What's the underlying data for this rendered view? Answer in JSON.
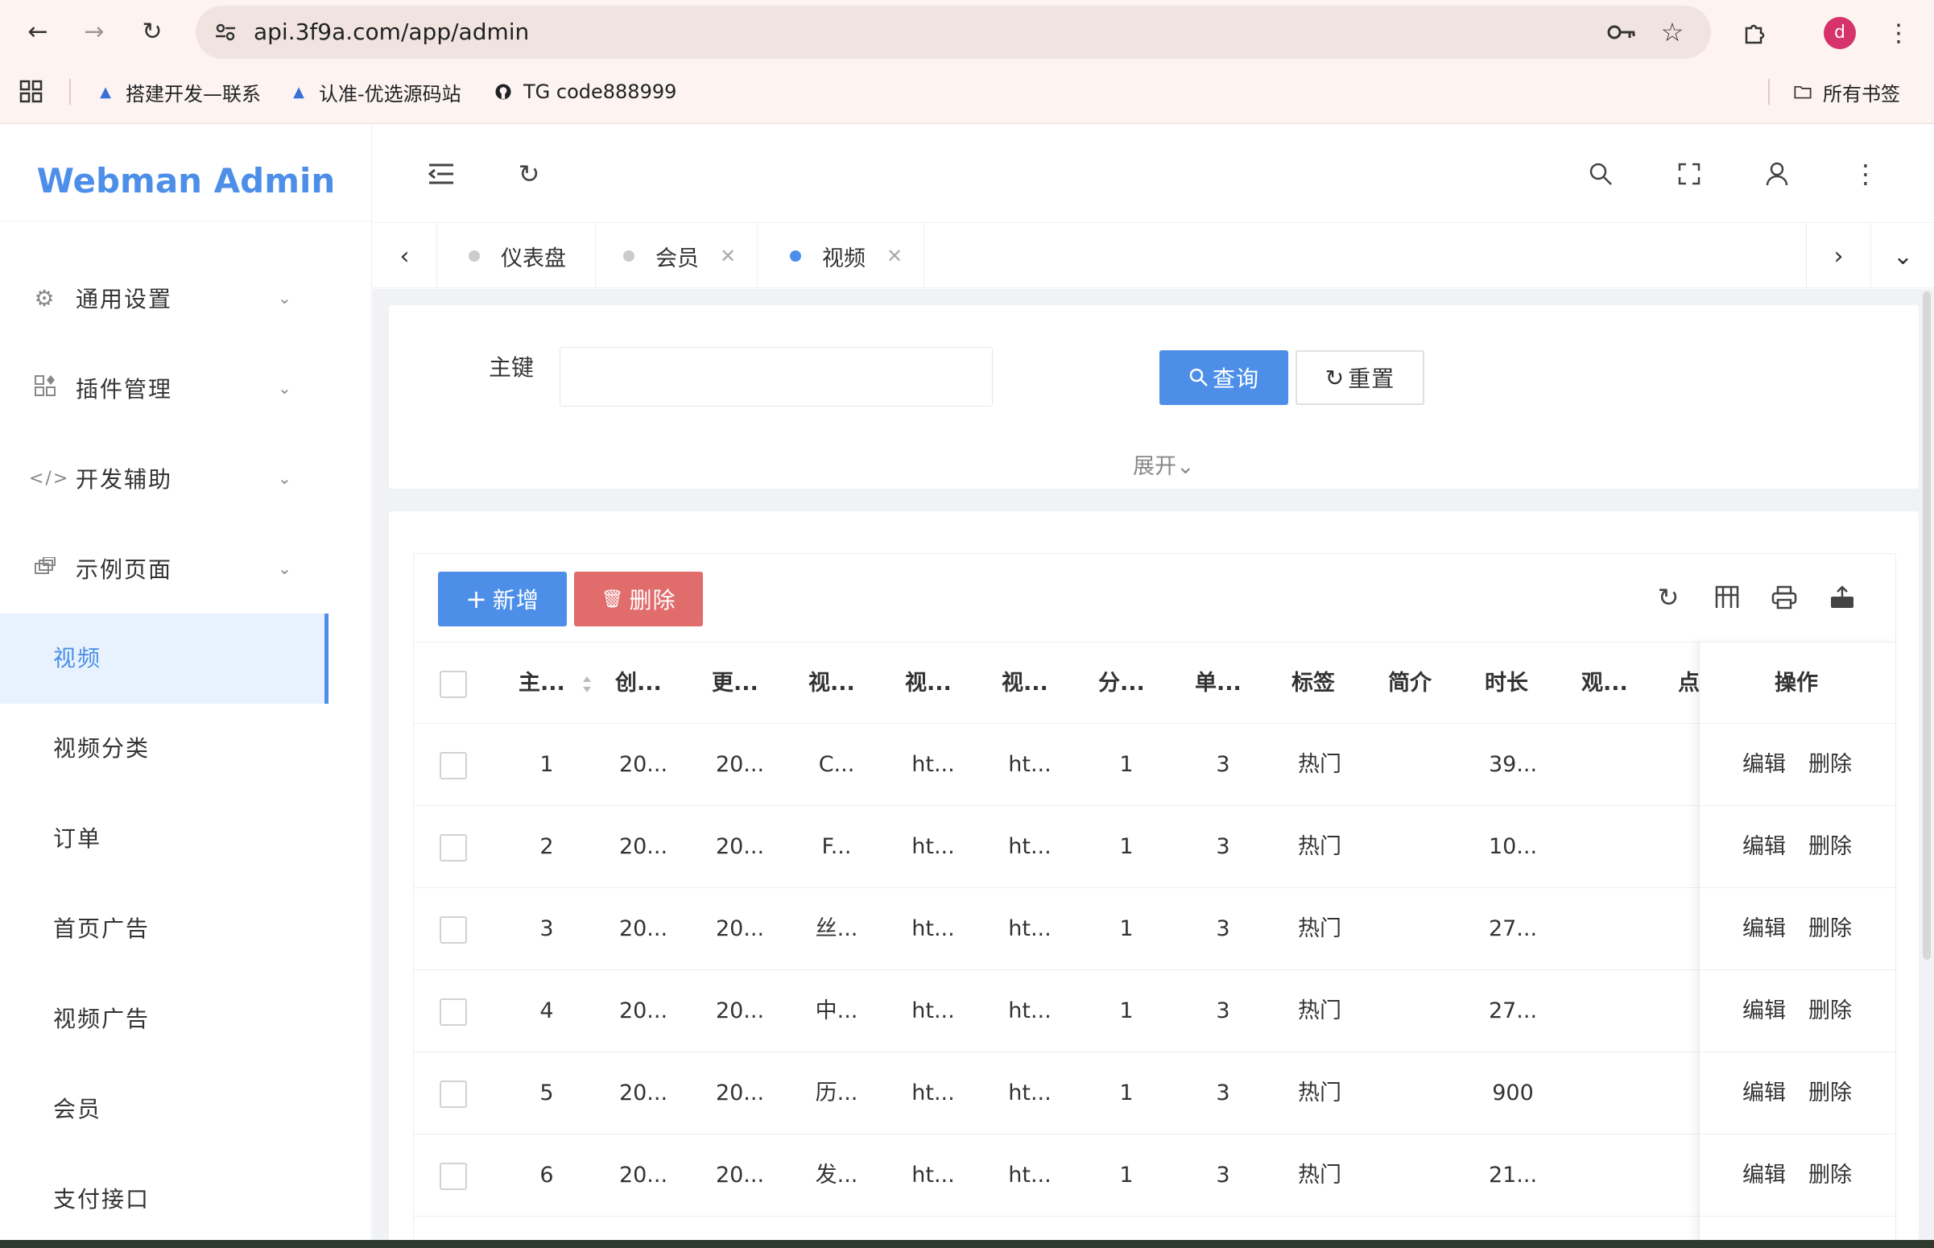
{
  "browser": {
    "url": "api.3f9a.com/app/admin",
    "avatar_letter": "d",
    "bookmarks": [
      {
        "label": "搭建开发—联系"
      },
      {
        "label": "认准-优选源码站"
      },
      {
        "label": "TG code888999"
      }
    ],
    "all_bookmarks": "所有书签"
  },
  "app": {
    "logo": "Webman Admin",
    "accent": "#4d8fe8",
    "sidebar": {
      "groups": [
        {
          "label": "通用设置",
          "icon": "gear-icon"
        },
        {
          "label": "插件管理",
          "icon": "plugin-icon"
        },
        {
          "label": "开发辅助",
          "icon": "code-icon"
        },
        {
          "label": "示例页面",
          "icon": "pages-icon"
        }
      ],
      "items": [
        {
          "label": "视频",
          "active": true
        },
        {
          "label": "视频分类"
        },
        {
          "label": "订单"
        },
        {
          "label": "首页广告"
        },
        {
          "label": "视频广告"
        },
        {
          "label": "会员"
        },
        {
          "label": "支付接口"
        }
      ]
    },
    "tabs": [
      {
        "label": "仪表盘",
        "closable": false
      },
      {
        "label": "会员",
        "closable": true
      },
      {
        "label": "视频",
        "closable": true,
        "active": true
      }
    ],
    "search": {
      "field_label": "主键",
      "query_label": "查询",
      "reset_label": "重置",
      "expand_label": "展开"
    },
    "toolbar": {
      "add_label": "新增",
      "delete_label": "删除"
    },
    "table": {
      "columns": [
        "主...",
        "创...",
        "更...",
        "视...",
        "视...",
        "视...",
        "分...",
        "单...",
        "标签",
        "简介",
        "时长",
        "观...",
        "点",
        "操作"
      ],
      "rows": [
        {
          "id": "1",
          "created": "20...",
          "updated": "20...",
          "title": "C...",
          "c4": "ht...",
          "c5": "ht...",
          "cat": "1",
          "single": "3",
          "tag": "热门",
          "intro": "",
          "duration": "39...",
          "views": ""
        },
        {
          "id": "2",
          "created": "20...",
          "updated": "20...",
          "title": "F...",
          "c4": "ht...",
          "c5": "ht...",
          "cat": "1",
          "single": "3",
          "tag": "热门",
          "intro": "",
          "duration": "10...",
          "views": ""
        },
        {
          "id": "3",
          "created": "20...",
          "updated": "20...",
          "title": "丝...",
          "c4": "ht...",
          "c5": "ht...",
          "cat": "1",
          "single": "3",
          "tag": "热门",
          "intro": "",
          "duration": "27...",
          "views": ""
        },
        {
          "id": "4",
          "created": "20...",
          "updated": "20...",
          "title": "中...",
          "c4": "ht...",
          "c5": "ht...",
          "cat": "1",
          "single": "3",
          "tag": "热门",
          "intro": "",
          "duration": "27...",
          "views": ""
        },
        {
          "id": "5",
          "created": "20...",
          "updated": "20...",
          "title": "历...",
          "c4": "ht...",
          "c5": "ht...",
          "cat": "1",
          "single": "3",
          "tag": "热门",
          "intro": "",
          "duration": "900",
          "views": ""
        },
        {
          "id": "6",
          "created": "20...",
          "updated": "20...",
          "title": "发...",
          "c4": "ht...",
          "c5": "ht...",
          "cat": "1",
          "single": "3",
          "tag": "热门",
          "intro": "",
          "duration": "21...",
          "views": ""
        }
      ],
      "edit_label": "编辑",
      "delete_label": "删除"
    }
  }
}
